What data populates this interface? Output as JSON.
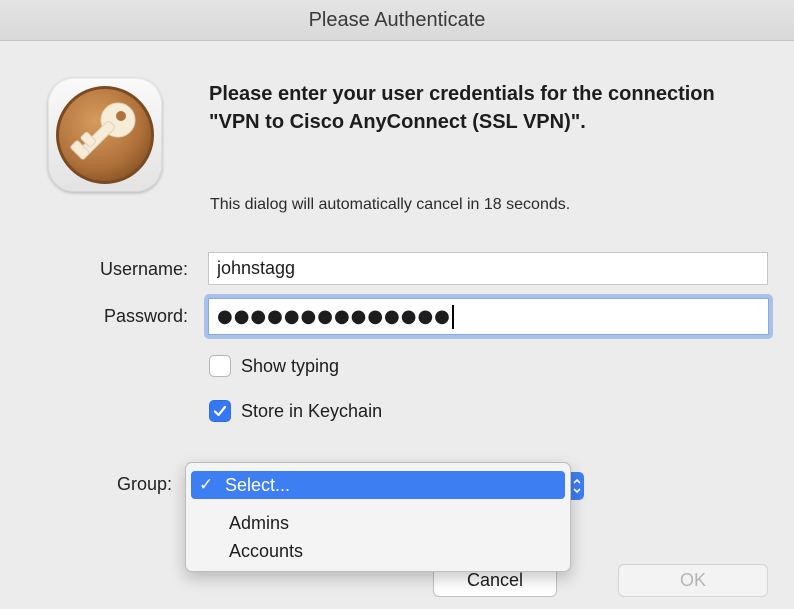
{
  "window": {
    "title": "Please Authenticate"
  },
  "icon": {
    "name": "keychain-key-icon"
  },
  "message": {
    "heading": "Please enter your user credentials for the connection \"VPN to Cisco AnyConnect (SSL VPN)\".",
    "countdown": "This dialog will automatically cancel in 18 seconds."
  },
  "form": {
    "username_label": "Username:",
    "username_value": "johnstagg",
    "password_label": "Password:",
    "password_masked": "●●●●●●●●●●●●●●",
    "show_typing_label": "Show typing",
    "show_typing_checked": false,
    "store_keychain_label": "Store in Keychain",
    "store_keychain_checked": true,
    "group_label": "Group:"
  },
  "group_menu": {
    "selected_check": "✓",
    "options": [
      "Select...",
      "Admins",
      "Accounts"
    ]
  },
  "buttons": {
    "cancel_label": "Cancel",
    "ok_label": "OK"
  },
  "colors": {
    "accent": "#3478f6",
    "menu_highlight": "#3d7ef2"
  }
}
